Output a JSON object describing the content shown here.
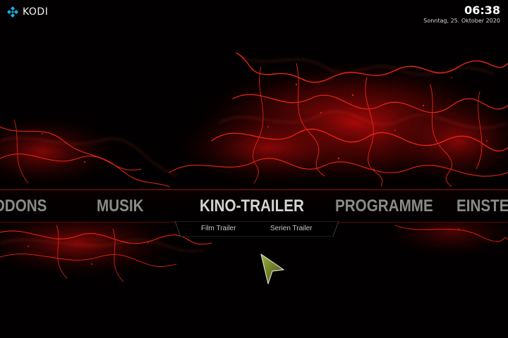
{
  "header": {
    "app_name": "KODI",
    "time": "06:38",
    "date": "Sonntag, 25. Oktober 2020"
  },
  "menu": {
    "items": [
      {
        "label": "ADDONS",
        "state": "partial-left"
      },
      {
        "label": "MUSIK"
      },
      {
        "label": "KINO-TRAILER",
        "state": "focused"
      },
      {
        "label": "PROGRAMME"
      },
      {
        "label": "EINSTELLUNGEN",
        "state": "partial-right"
      }
    ]
  },
  "submenu": {
    "items": [
      {
        "label": "Film Trailer"
      },
      {
        "label": "Serien Trailer"
      }
    ]
  },
  "colors": {
    "accent": "#d21010",
    "logo_blue": "#17b2e8",
    "background": "#000000",
    "menu_text": "#8a8a8a",
    "menu_focused": "#d4d4d4"
  },
  "icons": [
    "kodi-logo-icon",
    "mouse-pointer-icon"
  ]
}
